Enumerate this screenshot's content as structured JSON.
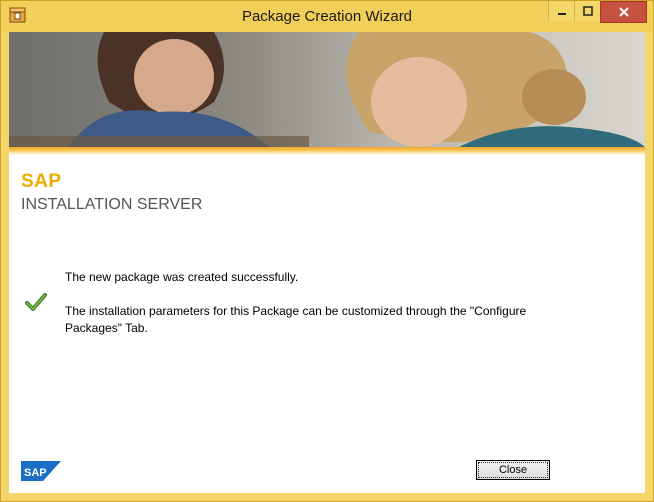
{
  "window": {
    "title": "Package Creation Wizard",
    "icon": "package-wizard-icon",
    "controls": [
      "minimize-icon",
      "maximize-icon",
      "close-icon"
    ]
  },
  "header": {
    "brand": "SAP",
    "product": "INSTALLATION SERVER",
    "accent_color": "#f0ab00"
  },
  "body": {
    "status_icon": "checkmark-icon",
    "success_message": "The new package was created successfully.",
    "info_message": "The installation parameters for this Package can be customized through the \"Configure Packages\" Tab."
  },
  "footer": {
    "logo_text": "SAP",
    "close_label": "Close"
  }
}
